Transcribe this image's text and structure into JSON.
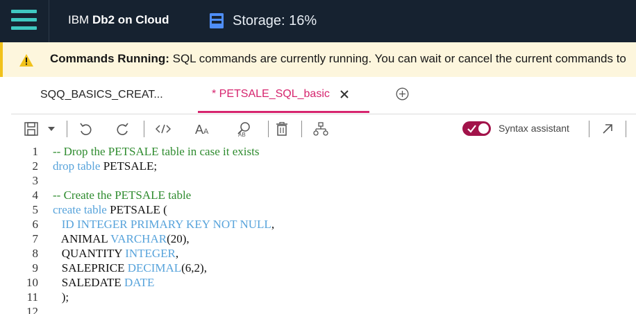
{
  "header": {
    "brand_prefix": "IBM",
    "brand_name": "Db2 on Cloud",
    "storage_text": "Storage: 16%"
  },
  "banner": {
    "title": "Commands Running:",
    "message": "SQL commands are currently running. You can wait or cancel the current commands to"
  },
  "tabs": [
    {
      "label": "SQQ_BASICS_CREAT..."
    },
    {
      "label": "* PETSALE_SQL_basic"
    }
  ],
  "toolbar": {
    "syntax_assistant_label": "Syntax assistant",
    "syntax_assistant_on": true
  },
  "editor": {
    "lines": [
      {
        "n": "1",
        "parts": [
          {
            "t": "-- Drop the PETSALE table in case it exists",
            "c": "cm"
          }
        ]
      },
      {
        "n": "2",
        "parts": [
          {
            "t": "drop table",
            "c": "kw"
          },
          {
            "t": " PETSALE;",
            "c": ""
          }
        ]
      },
      {
        "n": "3",
        "parts": []
      },
      {
        "n": "4",
        "parts": [
          {
            "t": "-- Create the PETSALE table",
            "c": "cm"
          }
        ]
      },
      {
        "n": "5",
        "parts": [
          {
            "t": "create table",
            "c": "kw"
          },
          {
            "t": " PETSALE (",
            "c": ""
          }
        ]
      },
      {
        "n": "6",
        "parts": [
          {
            "t": "   ",
            "c": ""
          },
          {
            "t": "ID INTEGER PRIMARY KEY NOT NULL",
            "c": "kw"
          },
          {
            "t": ",",
            "c": ""
          }
        ]
      },
      {
        "n": "7",
        "parts": [
          {
            "t": "   ANIMAL ",
            "c": ""
          },
          {
            "t": "VARCHAR",
            "c": "kw"
          },
          {
            "t": "(20),",
            "c": ""
          }
        ]
      },
      {
        "n": "8",
        "parts": [
          {
            "t": "   QUANTITY ",
            "c": ""
          },
          {
            "t": "INTEGER",
            "c": "kw"
          },
          {
            "t": ",",
            "c": ""
          }
        ]
      },
      {
        "n": "9",
        "parts": [
          {
            "t": "   SALEPRICE ",
            "c": ""
          },
          {
            "t": "DECIMAL",
            "c": "kw"
          },
          {
            "t": "(6,2),",
            "c": ""
          }
        ]
      },
      {
        "n": "10",
        "parts": [
          {
            "t": "   SALEDATE ",
            "c": ""
          },
          {
            "t": "DATE",
            "c": "kw"
          }
        ]
      },
      {
        "n": "11",
        "parts": [
          {
            "t": "   );",
            "c": ""
          }
        ]
      },
      {
        "n": "12",
        "parts": []
      }
    ]
  },
  "colors": {
    "header_bg": "#162230",
    "menu_accent": "#3fc8c0",
    "tab_active": "#d6246e",
    "toggle_on": "#a2134a",
    "comment": "#2e8b2e",
    "keyword": "#57a3db"
  }
}
